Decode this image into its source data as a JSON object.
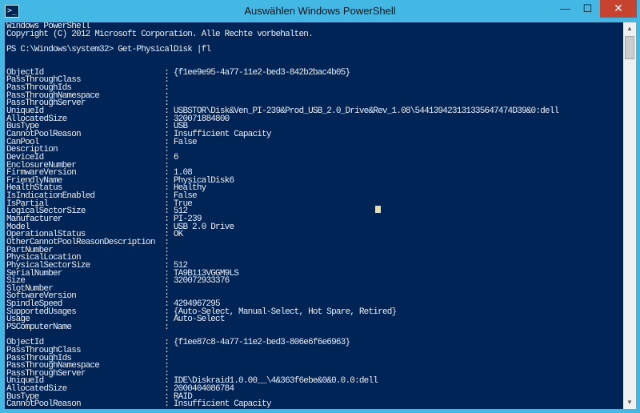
{
  "window": {
    "title": "Auswählen Windows PowerShell",
    "app_icon_glyph": ">_",
    "minimize_glyph": "—",
    "maximize_glyph": "☐",
    "close_glyph": "✕",
    "scroll_up_glyph": "▲",
    "scroll_down_glyph": "▼"
  },
  "console": {
    "lines": [
      "Windows PowerShell",
      "Copyright (C) 2012 Microsoft Corporation. Alle Rechte vorbehalten.",
      "",
      "PS C:\\Windows\\system32> Get-PhysicalDisk |fl",
      "",
      "",
      "ObjectId                          : {f1ee9e95-4a77-11e2-bed3-842b2bac4b05}",
      "PassThroughClass                  :",
      "PassThroughIds                    :",
      "PassThroughNamespace              :",
      "PassThroughServer                 :",
      "UniqueId                          : USBSTOR\\Disk&Ven_PI-239&Prod_USB_2.0_Drive&Rev_1.08\\544139423131335647474D39&0:dell",
      "AllocatedSize                     : 320071884800",
      "BusType                           : USB",
      "CannotPoolReason                  : Insufficient Capacity",
      "CanPool                           : False",
      "Description                       :",
      "DeviceId                          : 6",
      "EnclosureNumber                   :",
      "FirmwareVersion                   : 1.08",
      "FriendlyName                      : PhysicalDisk6",
      "HealthStatus                      : Healthy",
      "IsIndicationEnabled               : False",
      "IsPartial                         : True",
      "LogicalSectorSize                 : 512",
      "Manufacturer                      : PI-239",
      "Model                             : USB 2.0 Drive",
      "OperationalStatus                 : OK",
      "OtherCannotPoolReasonDescription  :",
      "PartNumber                        :",
      "PhysicalLocation                  :",
      "PhysicalSectorSize                : 512",
      "SerialNumber                      : TA9B113VGGM9LS",
      "Size                              : 320072933376",
      "SlotNumber                        :",
      "SoftwareVersion                   :",
      "SpindleSpeed                      : 4294967295",
      "SupportedUsages                   : {Auto-Select, Manual-Select, Hot Spare, Retired}",
      "Usage                             : Auto-Select",
      "PSComputerName                    :",
      "",
      "ObjectId                          : {f1ee87c8-4a77-11e2-bed3-806e6f6e6963}",
      "PassThroughClass                  :",
      "PassThroughIds                    :",
      "PassThroughNamespace              :",
      "PassThroughServer                 :",
      "UniqueId                          : IDE\\Diskraid1.0.00__\\4&363f6ebe&0&0.0.0:dell",
      "AllocatedSize                     : 2000404086784",
      "BusType                           : RAID",
      "CannotPoolReason                  : Insufficient Capacity"
    ]
  },
  "colors": {
    "console_background": "#012456",
    "console_text": "#eaeef2",
    "window_frame": "#44b8e4",
    "close_button": "#c7432f",
    "cursor": "#eedd99"
  }
}
